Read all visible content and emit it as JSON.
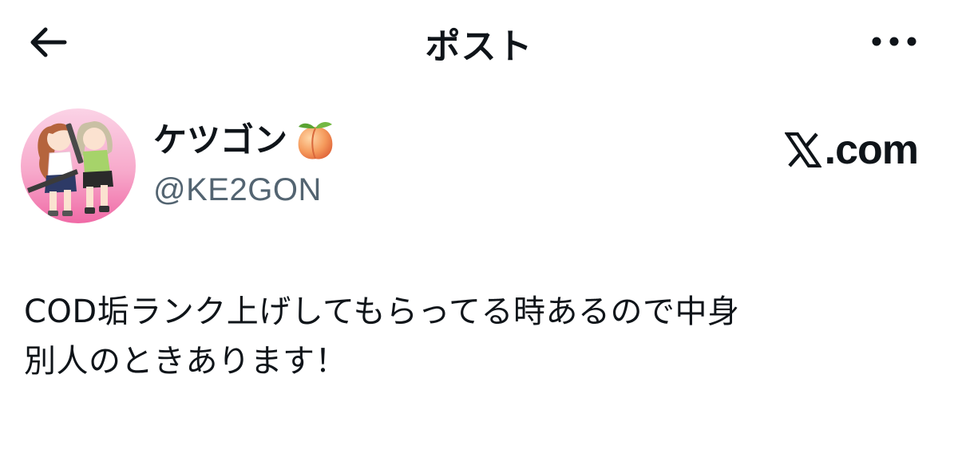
{
  "header": {
    "title": "ポスト",
    "back_icon": "arrow-left-icon",
    "more_icon": "more-horizontal-icon"
  },
  "author": {
    "display_name": "ケツゴン",
    "name_emoji": "peach-icon",
    "handle": "@KE2GON",
    "avatar_icon": "avatar-illustration"
  },
  "brand": {
    "logo_icon": "x-logo-icon",
    "text": ".com"
  },
  "post": {
    "lines": [
      "COD垢ランク上げしてもらってる時あるので中身",
      "別人のときあります！"
    ]
  },
  "colors": {
    "text_primary": "#0f1419",
    "text_secondary": "#536471",
    "background": "#ffffff",
    "avatar_pink": "#f3a0c4",
    "peach": "#f4a36a"
  }
}
